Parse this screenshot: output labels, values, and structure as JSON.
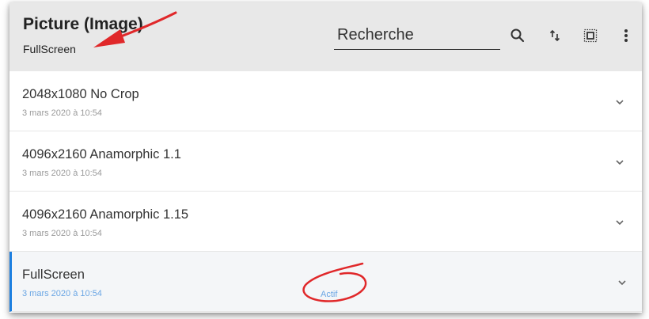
{
  "header": {
    "title": "Picture (Image)",
    "subtitle": "FullScreen",
    "search_placeholder": "Recherche",
    "icons": [
      "search-icon",
      "sort-icon",
      "select-all-icon",
      "more-vert-icon"
    ]
  },
  "presets": [
    {
      "name": "2048x1080 No Crop",
      "date": "3 mars 2020 à 10:54",
      "badge": "",
      "active": false
    },
    {
      "name": "4096x2160 Anamorphic 1.1",
      "date": "3 mars 2020 à 10:54",
      "badge": "",
      "active": false
    },
    {
      "name": "4096x2160 Anamorphic 1.15",
      "date": "3 mars 2020 à 10:54",
      "badge": "",
      "active": false
    },
    {
      "name": "FullScreen",
      "date": "3 mars 2020 à 10:54",
      "badge": "Actif",
      "active": true
    }
  ],
  "colors": {
    "accent": "#1d7fe0",
    "annotation": "#e0282a",
    "header_bg": "#e8e8e8"
  }
}
